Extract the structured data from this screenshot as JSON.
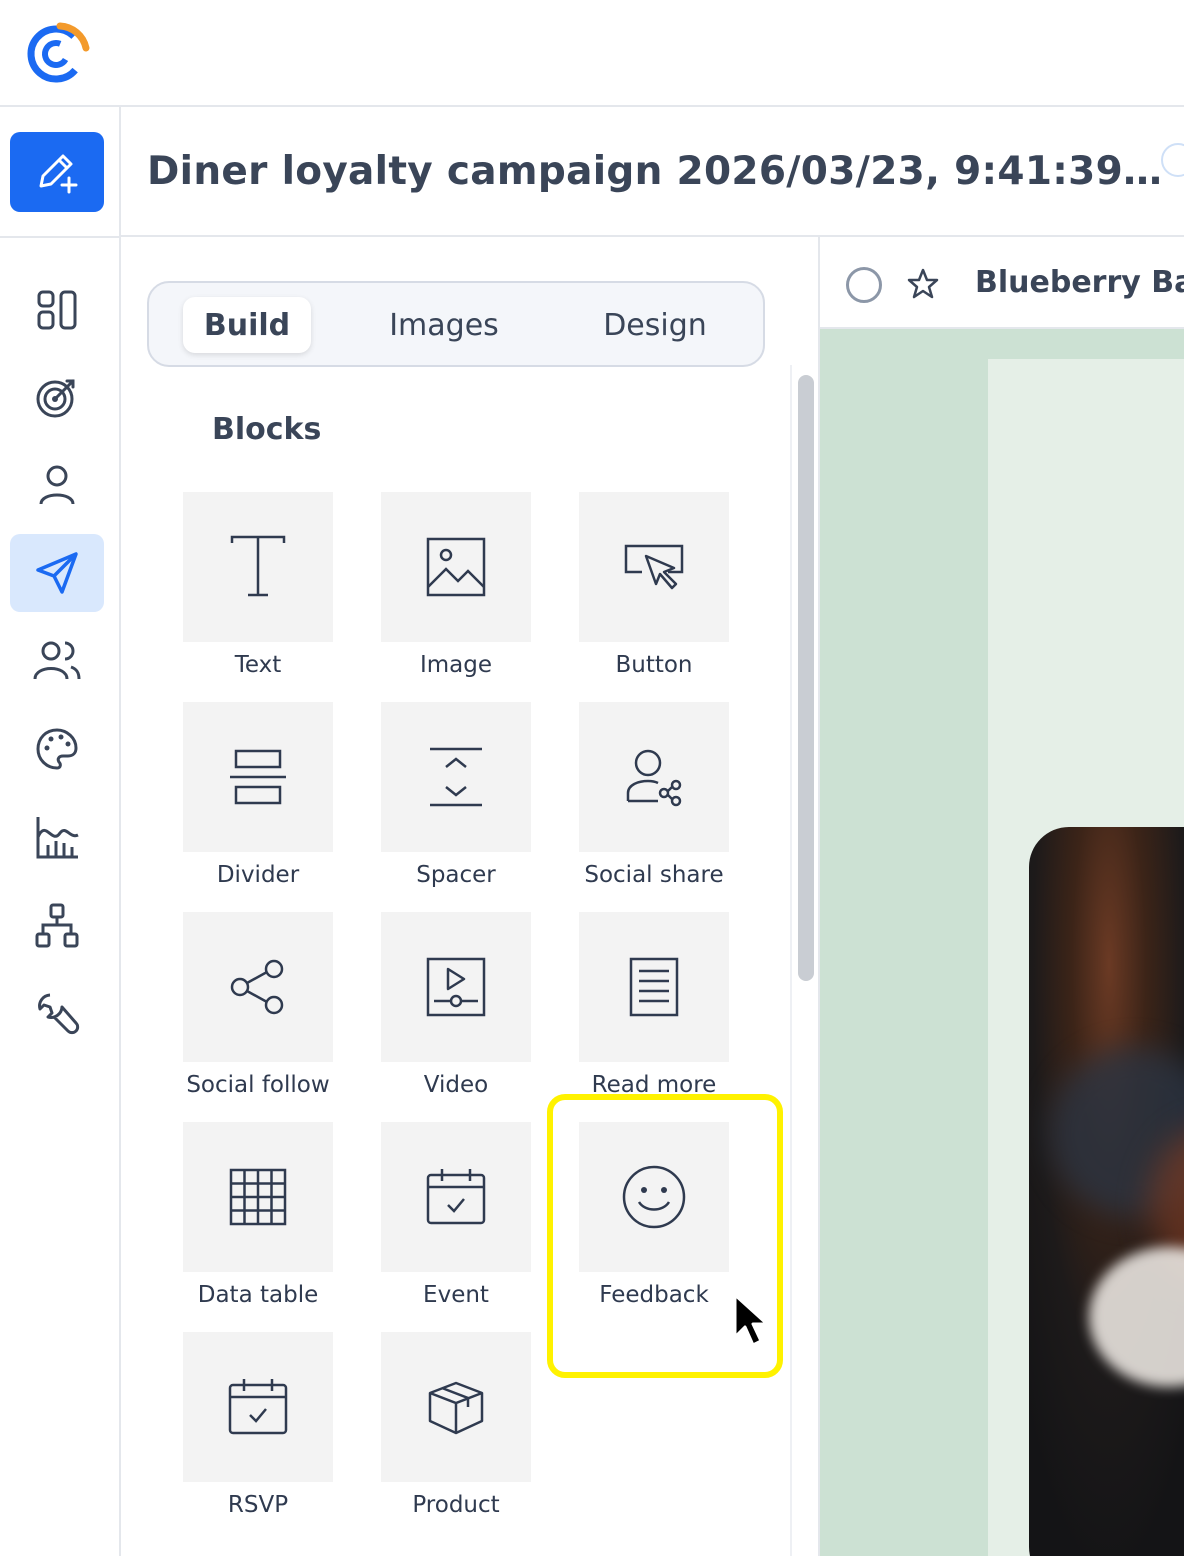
{
  "header": {
    "campaign_title": "Diner loyalty campaign 2026/03/23, 9:41:39…"
  },
  "nav": {
    "items": [
      {
        "icon": "dashboard-icon"
      },
      {
        "icon": "target-icon"
      },
      {
        "icon": "contacts-icon"
      },
      {
        "icon": "campaigns-icon",
        "active": true
      },
      {
        "icon": "audience-icon"
      },
      {
        "icon": "palette-icon"
      },
      {
        "icon": "reports-icon"
      },
      {
        "icon": "integrations-icon"
      },
      {
        "icon": "tools-icon"
      }
    ]
  },
  "panel": {
    "tabs": [
      {
        "label": "Build",
        "active": true
      },
      {
        "label": "Images",
        "active": false
      },
      {
        "label": "Design",
        "active": false
      }
    ],
    "section_title": "Blocks",
    "blocks": [
      {
        "label": "Text",
        "icon": "text-icon"
      },
      {
        "label": "Image",
        "icon": "image-icon"
      },
      {
        "label": "Button",
        "icon": "button-icon"
      },
      {
        "label": "Divider",
        "icon": "divider-icon"
      },
      {
        "label": "Spacer",
        "icon": "spacer-icon"
      },
      {
        "label": "Social share",
        "icon": "social-share-icon"
      },
      {
        "label": "Social follow",
        "icon": "social-follow-icon"
      },
      {
        "label": "Video",
        "icon": "video-icon"
      },
      {
        "label": "Read more",
        "icon": "read-more-icon"
      },
      {
        "label": "Data table",
        "icon": "data-table-icon"
      },
      {
        "label": "Event",
        "icon": "event-icon"
      },
      {
        "label": "Feedback",
        "icon": "feedback-icon",
        "highlighted": true
      },
      {
        "label": "RSVP",
        "icon": "rsvp-icon"
      },
      {
        "label": "Product",
        "icon": "product-icon"
      }
    ]
  },
  "preview": {
    "name": "Blueberry Bak"
  },
  "colors": {
    "accent": "#1b6af2",
    "nav_active_bg": "#d9e8fd",
    "highlight": "#fff200",
    "preview_bg": "#cce1d3"
  }
}
